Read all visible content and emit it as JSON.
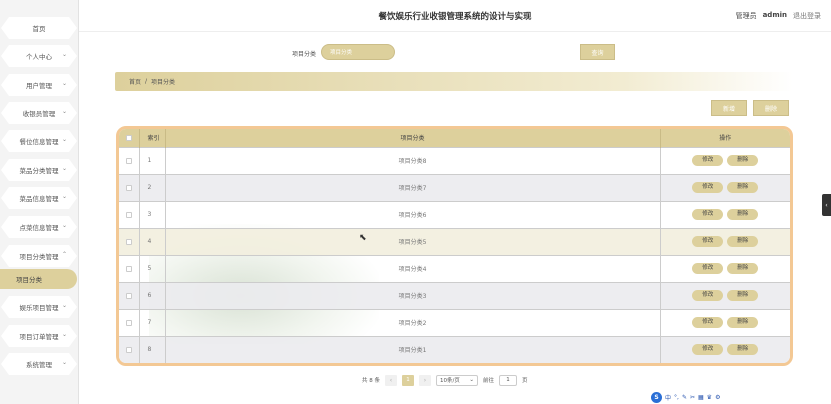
{
  "header": {
    "title": "餐饮娱乐行业收银管理系统的设计与实现",
    "role": "管理员",
    "user": "admin",
    "logout": "退出登录"
  },
  "sidebar": {
    "items": [
      {
        "label": "首页"
      },
      {
        "label": "个人中心"
      },
      {
        "label": "用户管理"
      },
      {
        "label": "收银员管理"
      },
      {
        "label": "餐位信息管理"
      },
      {
        "label": "菜品分类管理"
      },
      {
        "label": "菜品信息管理"
      },
      {
        "label": "点菜信息管理"
      },
      {
        "label": "项目分类管理"
      },
      {
        "label": "娱乐项目管理"
      },
      {
        "label": "项目订单管理"
      },
      {
        "label": "系统管理"
      }
    ],
    "active_sub": "项目分类"
  },
  "search": {
    "label": "项目分类",
    "placeholder": "项目分类",
    "button": "查询"
  },
  "breadcrumb": {
    "home": "首页",
    "sep": "/",
    "current": "项目分类"
  },
  "actions": {
    "add": "新增",
    "delete": "删除"
  },
  "table": {
    "headers": {
      "index": "索引",
      "name": "项目分类",
      "ops": "操作"
    },
    "rows": [
      {
        "index": "1",
        "name": "项目分类8"
      },
      {
        "index": "2",
        "name": "项目分类7"
      },
      {
        "index": "3",
        "name": "项目分类6"
      },
      {
        "index": "4",
        "name": "项目分类5"
      },
      {
        "index": "5",
        "name": "项目分类4"
      },
      {
        "index": "6",
        "name": "项目分类3"
      },
      {
        "index": "7",
        "name": "项目分类2"
      },
      {
        "index": "8",
        "name": "项目分类1"
      }
    ],
    "edit_label": "修改",
    "delete_label": "删除"
  },
  "pagination": {
    "total": "共 8 条",
    "prev": "‹",
    "current": "1",
    "next": "›",
    "page_size": "10条/页",
    "goto": "前往",
    "goto_value": "1",
    "page_unit": "页"
  },
  "ime": {
    "lang": "中"
  }
}
